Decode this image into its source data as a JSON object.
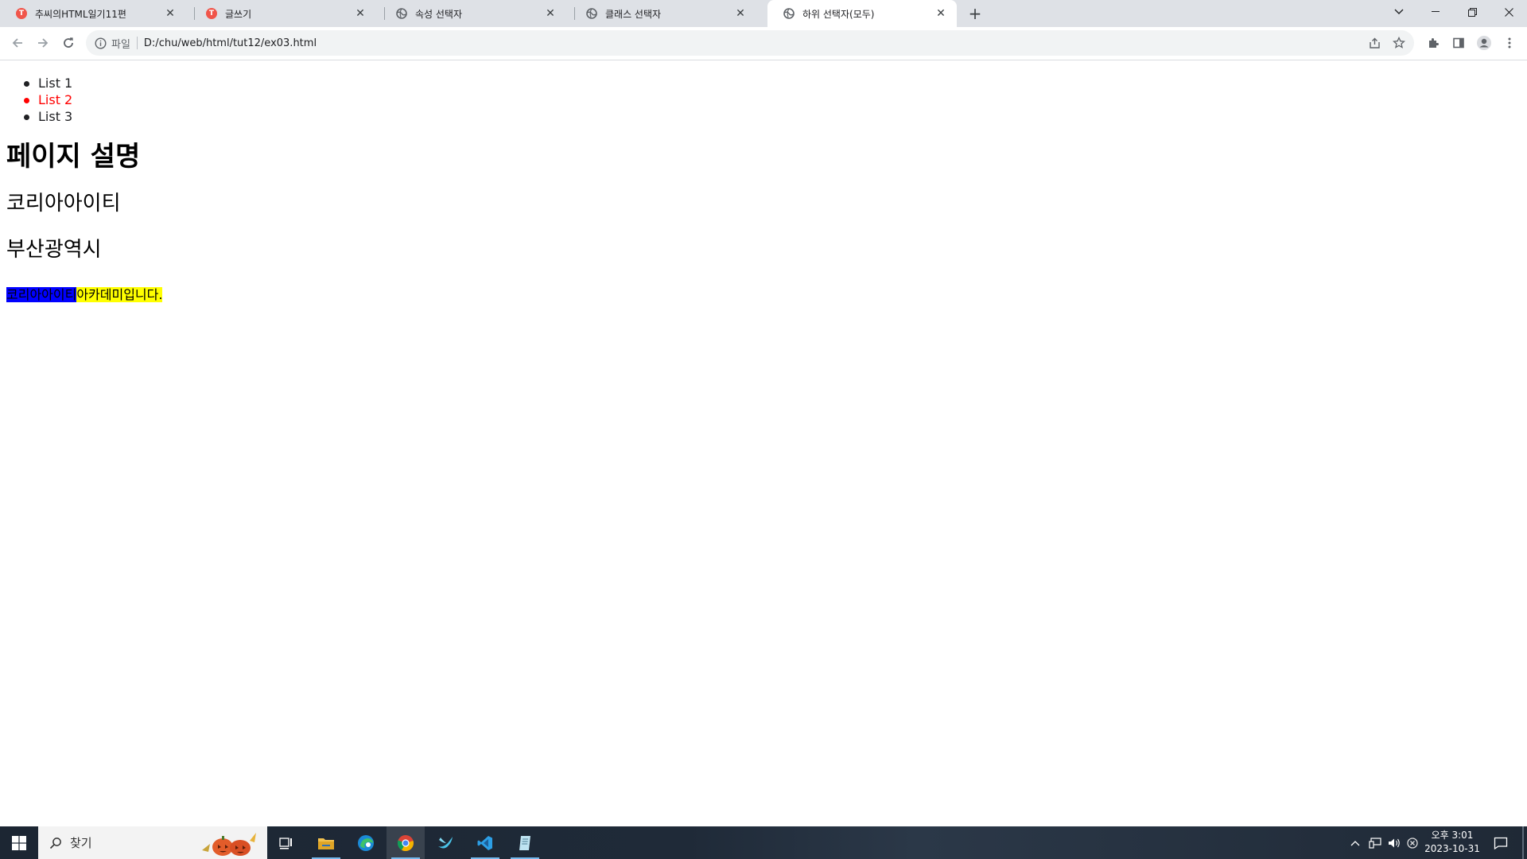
{
  "browser": {
    "tabs": [
      {
        "title": "추씨의HTML일기11편",
        "favicon": "t-logo-icon",
        "active": false
      },
      {
        "title": "글쓰기",
        "favicon": "t-logo-icon",
        "active": false
      },
      {
        "title": "속성 선택자",
        "favicon": "globe-icon",
        "active": false
      },
      {
        "title": "클래스 선택자",
        "favicon": "globe-icon",
        "active": false
      },
      {
        "title": "하위 선택자(모두)",
        "favicon": "globe-icon",
        "active": true
      }
    ],
    "favicon_letter": "T",
    "address": {
      "chip": "파일",
      "url": "D:/chu/web/html/tut12/ex03.html"
    }
  },
  "page": {
    "list": [
      {
        "text": "List 1",
        "color": "#202124"
      },
      {
        "text": "List 2",
        "color": "#ff0000"
      },
      {
        "text": "List 3",
        "color": "#202124"
      }
    ],
    "heading": "페이지 설명",
    "p1": "코리아아이티",
    "p2": "부산광역시",
    "para_span_blue": "코리아아이티",
    "para_span_yellow": "아카데미입니다."
  },
  "taskbar": {
    "search_placeholder": "찾기",
    "clock_time": "오후 3:01",
    "clock_date": "2023-10-31"
  },
  "colors": {
    "highlight_blue": "#0000ff",
    "highlight_yellow": "#ffff00",
    "list_accent": "#ff0000"
  }
}
